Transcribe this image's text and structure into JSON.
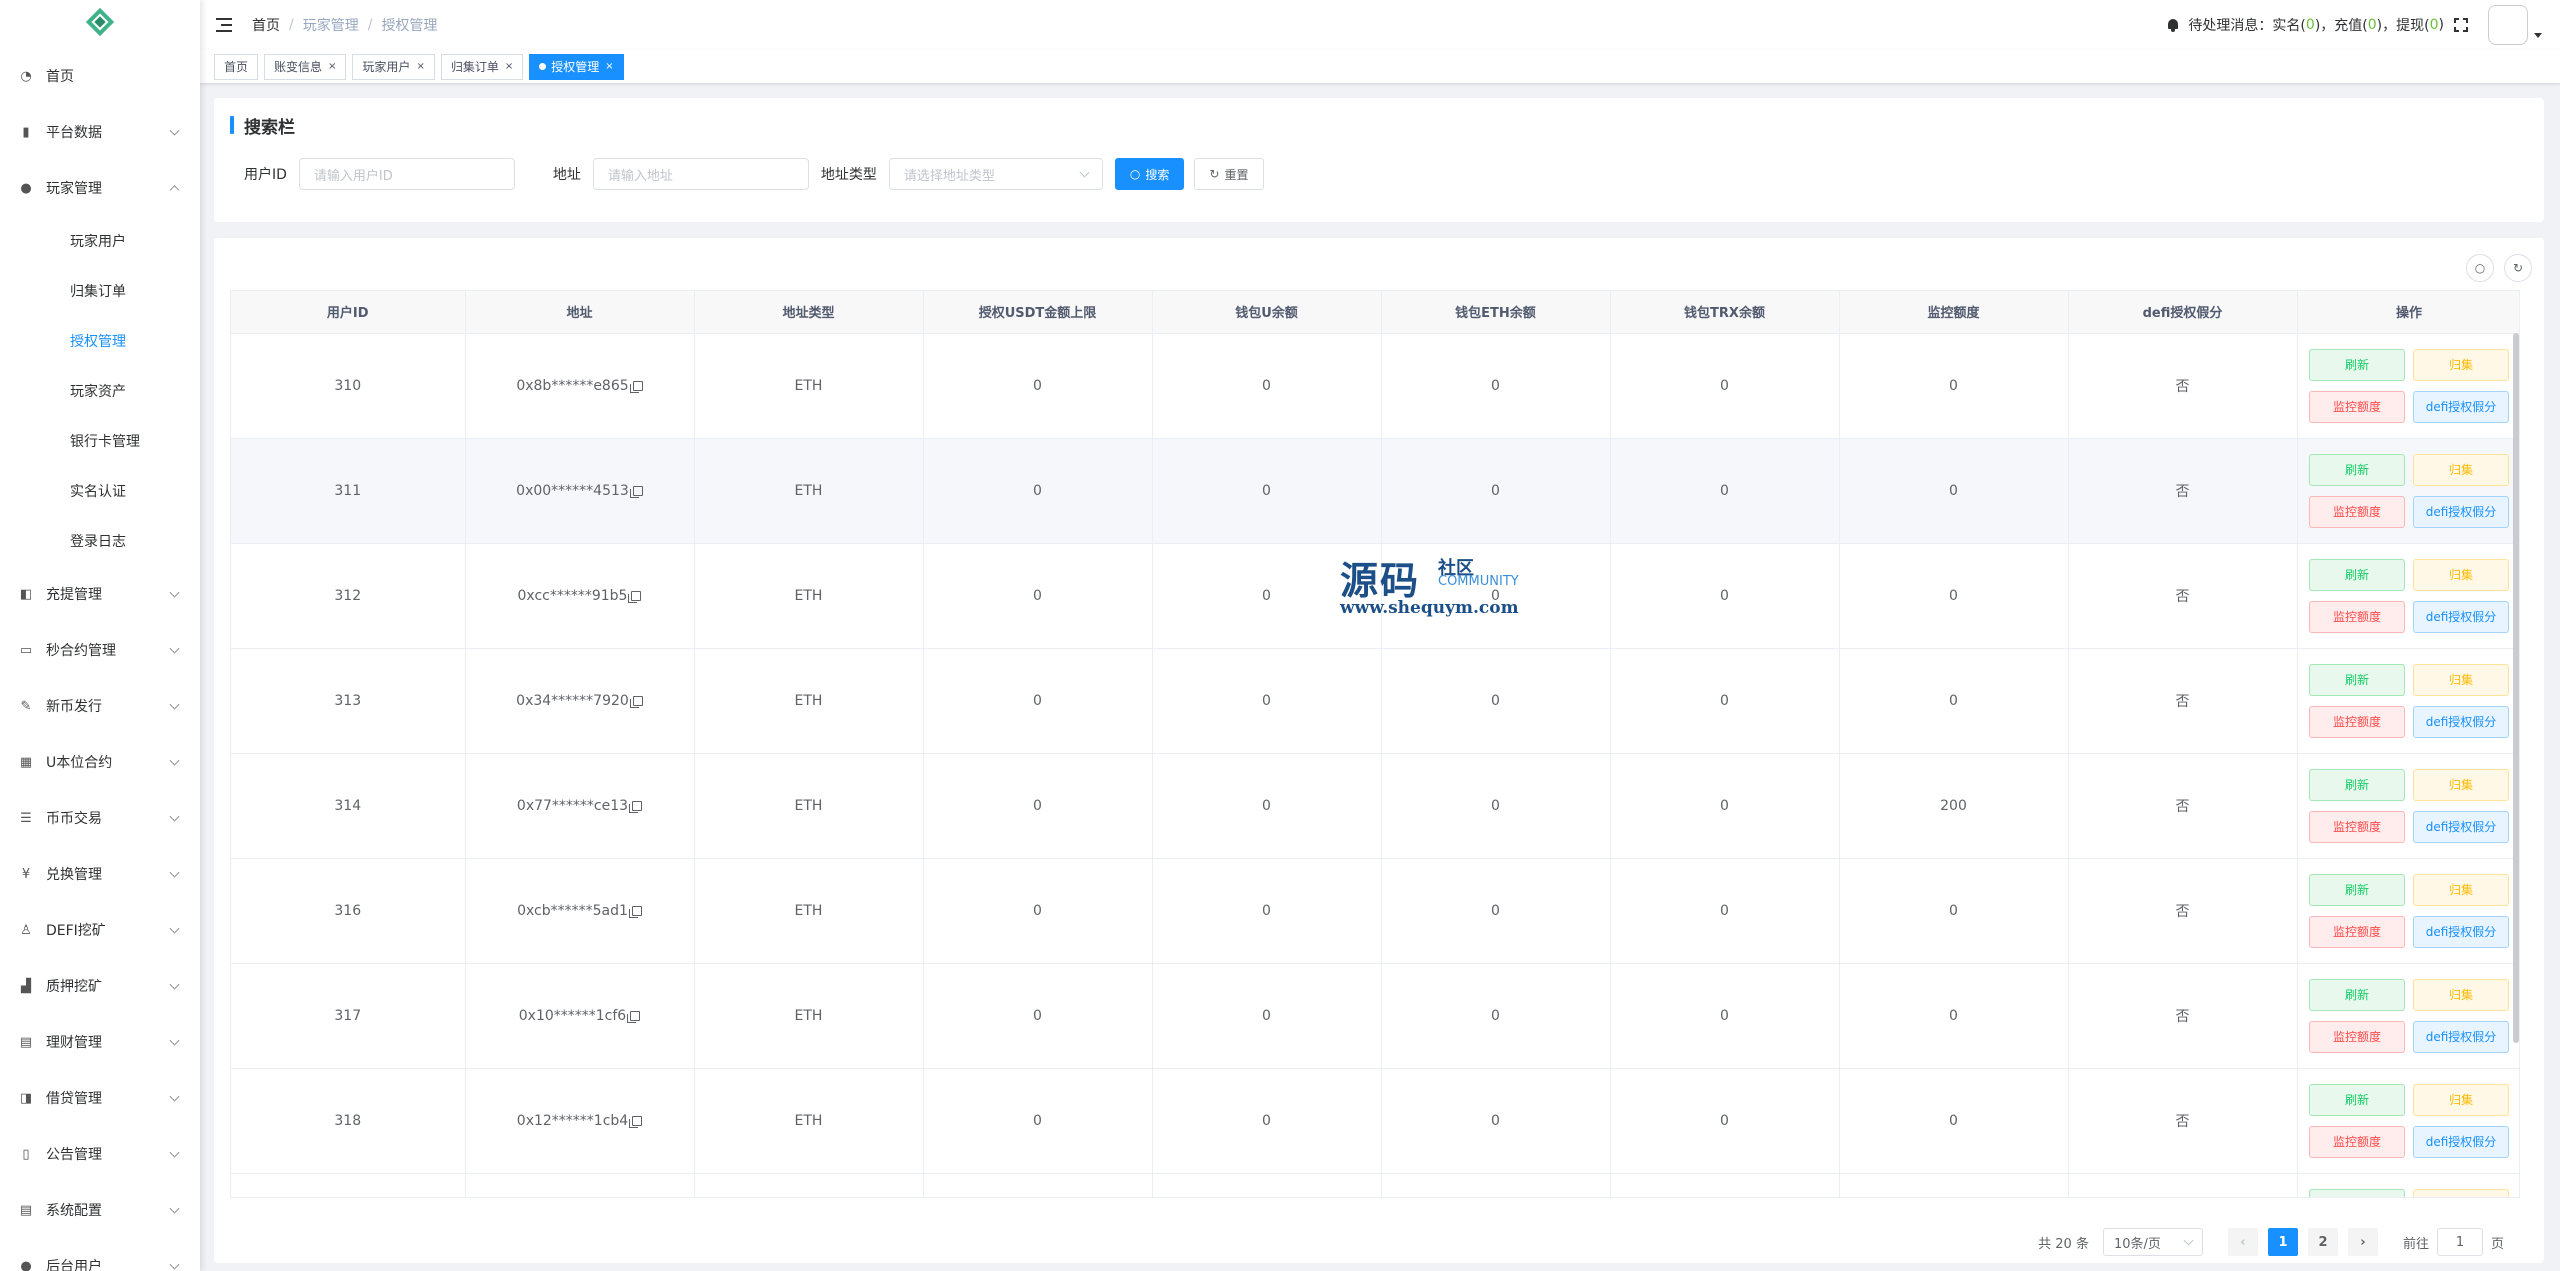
{
  "sidebar": {
    "items": [
      {
        "label": "首页",
        "icon": "dashboard-icon",
        "glyph": "◔",
        "chevron": "none"
      },
      {
        "label": "平台数据",
        "icon": "data-icon",
        "glyph": "▮",
        "chevron": "down"
      },
      {
        "label": "玩家管理",
        "icon": "user-icon",
        "glyph": "●",
        "chevron": "up",
        "children": [
          "玩家用户",
          "归集订单",
          "授权管理",
          "玩家资产",
          "银行卡管理",
          "实名认证",
          "登录日志"
        ],
        "active_child": 2
      },
      {
        "label": "充提管理",
        "icon": "copy-icon",
        "glyph": "◧",
        "chevron": "down"
      },
      {
        "label": "秒合约管理",
        "icon": "monitor-icon",
        "glyph": "▭",
        "chevron": "down"
      },
      {
        "label": "新币发行",
        "icon": "edit-icon",
        "glyph": "✎",
        "chevron": "down"
      },
      {
        "label": "U本位合约",
        "icon": "grid-icon",
        "glyph": "▦",
        "chevron": "down"
      },
      {
        "label": "币币交易",
        "icon": "list-icon",
        "glyph": "☰",
        "chevron": "down"
      },
      {
        "label": "兑换管理",
        "icon": "yen-icon",
        "glyph": "¥",
        "chevron": "down"
      },
      {
        "label": "DEFI挖矿",
        "icon": "people-icon",
        "glyph": "♙",
        "chevron": "down"
      },
      {
        "label": "质押挖矿",
        "icon": "chart-icon",
        "glyph": "▟",
        "chevron": "down"
      },
      {
        "label": "理财管理",
        "icon": "document-icon",
        "glyph": "▤",
        "chevron": "down"
      },
      {
        "label": "借贷管理",
        "icon": "wallet-icon",
        "glyph": "◨",
        "chevron": "down"
      },
      {
        "label": "公告管理",
        "icon": "book-icon",
        "glyph": "▯",
        "chevron": "down"
      },
      {
        "label": "系统配置",
        "icon": "settings-doc-icon",
        "glyph": "▤",
        "chevron": "down"
      },
      {
        "label": "后台用户",
        "icon": "admin-icon",
        "glyph": "●",
        "chevron": "down"
      }
    ]
  },
  "header": {
    "breadcrumb": [
      "首页",
      "玩家管理",
      "授权管理"
    ],
    "pending_label": "待处理消息：",
    "realname_label": "实名(",
    "realname_count": " 0 ",
    "recharge_label": ")，充值(",
    "recharge_count": " 0 ",
    "withdraw_label": ")，提现(",
    "withdraw_count": " 0 ",
    "close_paren": ")"
  },
  "tags": [
    {
      "label": "首页",
      "closable": false,
      "active": false
    },
    {
      "label": "账变信息",
      "closable": true,
      "active": false
    },
    {
      "label": "玩家用户",
      "closable": true,
      "active": false
    },
    {
      "label": "归集订单",
      "closable": true,
      "active": false
    },
    {
      "label": "授权管理",
      "closable": true,
      "active": true
    }
  ],
  "search": {
    "title": "搜索栏",
    "user_id_label": "用户ID",
    "user_id_placeholder": "请输入用户ID",
    "address_label": "地址",
    "address_placeholder": "请输入地址",
    "address_type_label": "地址类型",
    "address_type_placeholder": "请选择地址类型",
    "search_button": "搜索",
    "reset_button": "重置"
  },
  "table": {
    "columns": [
      "用户ID",
      "地址",
      "地址类型",
      "授权USDT金额上限",
      "钱包U余额",
      "钱包ETH余额",
      "钱包TRX余额",
      "监控额度",
      "defi授权假分",
      "操作"
    ],
    "rows": [
      {
        "user_id": "310",
        "address": "0x8b******e865",
        "type": "ETH",
        "usdt_limit": "0",
        "u_balance": "0",
        "eth_balance": "0",
        "trx_balance": "0",
        "monitor": "0",
        "defi": "否"
      },
      {
        "user_id": "311",
        "address": "0x00******4513",
        "type": "ETH",
        "usdt_limit": "0",
        "u_balance": "0",
        "eth_balance": "0",
        "trx_balance": "0",
        "monitor": "0",
        "defi": "否"
      },
      {
        "user_id": "312",
        "address": "0xcc******91b5",
        "type": "ETH",
        "usdt_limit": "0",
        "u_balance": "0",
        "eth_balance": "0",
        "trx_balance": "0",
        "monitor": "0",
        "defi": "否"
      },
      {
        "user_id": "313",
        "address": "0x34******7920",
        "type": "ETH",
        "usdt_limit": "0",
        "u_balance": "0",
        "eth_balance": "0",
        "trx_balance": "0",
        "monitor": "0",
        "defi": "否"
      },
      {
        "user_id": "314",
        "address": "0x77******ce13",
        "type": "ETH",
        "usdt_limit": "0",
        "u_balance": "0",
        "eth_balance": "0",
        "trx_balance": "0",
        "monitor": "200",
        "defi": "否"
      },
      {
        "user_id": "316",
        "address": "0xcb******5ad1",
        "type": "ETH",
        "usdt_limit": "0",
        "u_balance": "0",
        "eth_balance": "0",
        "trx_balance": "0",
        "monitor": "0",
        "defi": "否"
      },
      {
        "user_id": "317",
        "address": "0x10******1cf6",
        "type": "ETH",
        "usdt_limit": "0",
        "u_balance": "0",
        "eth_balance": "0",
        "trx_balance": "0",
        "monitor": "0",
        "defi": "否"
      },
      {
        "user_id": "318",
        "address": "0x12******1cb4",
        "type": "ETH",
        "usdt_limit": "0",
        "u_balance": "0",
        "eth_balance": "0",
        "trx_balance": "0",
        "monitor": "0",
        "defi": "否"
      },
      {
        "user_id": "",
        "address": "",
        "type": "",
        "usdt_limit": "",
        "u_balance": "",
        "eth_balance": "",
        "trx_balance": "",
        "monitor": "",
        "defi": ""
      }
    ],
    "actions": {
      "refresh": "刷新",
      "collect": "归集",
      "monitor": "监控额度",
      "defi": "defi授权假分"
    }
  },
  "pagination": {
    "total": "共 20 条",
    "page_size": "10条/页",
    "pages": [
      "1",
      "2"
    ],
    "current": "1",
    "goto_label": "前往",
    "goto_value": "1",
    "page_suffix": "页"
  },
  "watermark": {
    "big": "源码",
    "small": "社区",
    "en": "COMMUNITY",
    "url": "www.shequym.com"
  },
  "colors": {
    "primary": "#1890ff",
    "success": "#13ce66",
    "warning": "#ffba00",
    "danger": "#ff4949",
    "logo": "#3fb28a"
  }
}
